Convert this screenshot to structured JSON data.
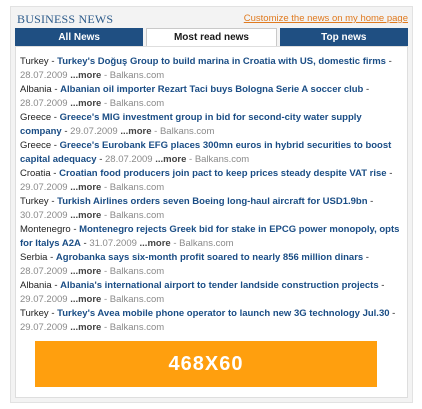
{
  "header": {
    "title": "BUSINESS NEWS",
    "customize_link": "Customize the news on my home page"
  },
  "tabs": [
    {
      "label": "All News",
      "active": false
    },
    {
      "label": "Most read news",
      "active": true
    },
    {
      "label": "Top news",
      "active": false
    }
  ],
  "news": [
    {
      "country": "Turkey",
      "headline": "Turkey's Doğuş Group to build marina in Croatia with US, domestic firms",
      "date": "28.07.2009",
      "more": "...more",
      "source": "Balkans.com"
    },
    {
      "country": "Albania",
      "headline": "Albanian oil importer Rezart Taci buys Bologna Serie A soccer club",
      "date": "28.07.2009",
      "more": "...more",
      "source": "Balkans.com"
    },
    {
      "country": "Greece",
      "headline": "Greece's MIG investment group in bid for second-city water supply company",
      "date": "29.07.2009",
      "more": "...more",
      "source": "Balkans.com"
    },
    {
      "country": "Greece",
      "headline": "Greece's Eurobank EFG places 300mn euros in hybrid securities to boost capital adequacy",
      "date": "28.07.2009",
      "more": "...more",
      "source": "Balkans.com"
    },
    {
      "country": "Croatia",
      "headline": "Croatian food producers join pact to keep prices steady despite VAT rise",
      "date": "29.07.2009",
      "more": "...more",
      "source": "Balkans.com"
    },
    {
      "country": "Turkey",
      "headline": "Turkish Airlines orders seven Boeing long-haul aircraft for USD1.9bn",
      "date": "30.07.2009",
      "more": "...more",
      "source": "Balkans.com"
    },
    {
      "country": "Montenegro",
      "headline": "Montenegro rejects Greek bid for stake in EPCG power monopoly, opts for Italys A2A",
      "date": "31.07.2009",
      "more": "...more",
      "source": "Balkans.com"
    },
    {
      "country": "Serbia",
      "headline": "Agrobanka says six-month profit soared to nearly 856 million dinars",
      "date": "28.07.2009",
      "more": "...more",
      "source": "Balkans.com"
    },
    {
      "country": "Albania",
      "headline": "Albania's international airport to tender landside construction projects",
      "date": "29.07.2009",
      "more": "...more",
      "source": "Balkans.com"
    },
    {
      "country": "Turkey",
      "headline": "Turkey's Avea mobile phone operator to launch new 3G technology Jul.30",
      "date": "29.07.2009",
      "more": "...more",
      "source": "Balkans.com"
    }
  ],
  "separators": {
    "dash": " - ",
    "source_sep": " - "
  },
  "ad": {
    "label": "468X60"
  },
  "colors": {
    "accent": "#e07a1f",
    "tab": "#1f4f82",
    "headline": "#1a4d85",
    "ad": "#ff9f0e"
  }
}
